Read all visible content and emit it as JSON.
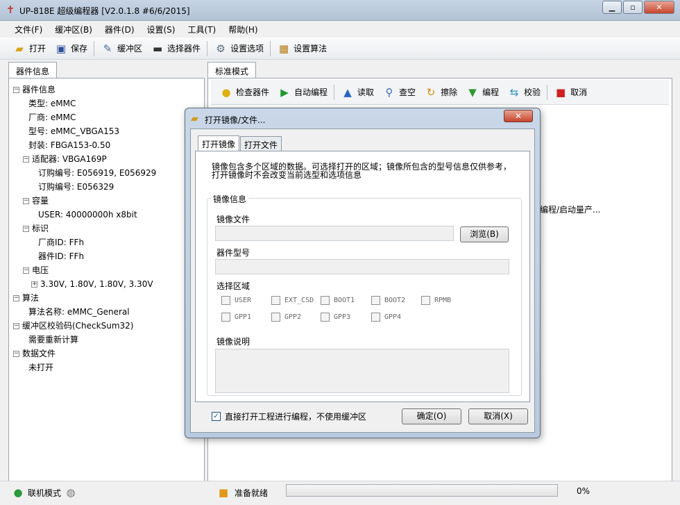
{
  "window": {
    "title": "UP-818E 超级编程器  [V2.0.1.8 #6/6/2015]",
    "minimize": "▁",
    "maximize": "▫",
    "close": "✕"
  },
  "menu": [
    "文件(F)",
    "缓冲区(B)",
    "器件(D)",
    "设置(S)",
    "工具(T)",
    "帮助(H)"
  ],
  "toolbar": {
    "open": "打开",
    "save": "保存",
    "buffer": "缓冲区",
    "select_device": "选择器件",
    "options": "设置选项",
    "algorithm": "设置算法"
  },
  "left_panel": {
    "tab": "器件信息",
    "tree": {
      "device_info": "器件信息",
      "type": "类型: eMMC",
      "vendor": "厂商: eMMC",
      "model": "型号: eMMC_VBGA153",
      "package": "封装: FBGA153-0.50",
      "adapter": "适配器: VBGA169P",
      "order1": "订购编号: E056919, E056929",
      "order2": "订购编号: E056329",
      "capacity": "容量",
      "user_cap": "USER: 40000000h x8bit",
      "ident": "标识",
      "vendor_id": "厂商ID: FFh",
      "device_id": "器件ID: FFh",
      "voltage": "电压",
      "voltage_vals": "3.30V, 1.80V, 1.80V, 3.30V",
      "algo": "算法",
      "algo_name": "算法名称: eMMC_General",
      "checksum": "缓冲区校验码(CheckSum32)",
      "checksum_val": "需要重新计算",
      "datafile": "数据文件",
      "datafile_val": "未打开"
    }
  },
  "right_panel": {
    "tab": "标准模式",
    "buttons": {
      "check": "检查器件",
      "auto": "自动编程",
      "read": "读取",
      "blank": "查空",
      "erase": "擦除",
      "program": "编程",
      "verify": "校验",
      "cancel": "取消"
    },
    "log_fragment": "动编程/启动量产..."
  },
  "dialog": {
    "title": "打开镜像/文件...",
    "tabs": [
      "打开镜像",
      "打开文件"
    ],
    "description_line1": "镜像包含多个区域的数据。可选择打开的区域；镜像所包含的型号信息仅供参考，",
    "description_line2": "打开镜像时不会改变当前选型和选项信息",
    "group_title": "镜像信息",
    "image_file_label": "镜像文件",
    "image_file_value": "",
    "browse": "浏览(B)",
    "device_model_label": "器件型号",
    "device_model_value": "",
    "select_region_label": "选择区域",
    "regions": [
      "USER",
      "EXT_CSD",
      "BOOT1",
      "BOOT2",
      "RPMB",
      "GPP1",
      "GPP2",
      "GPP3",
      "GPP4"
    ],
    "image_desc_label": "镜像说明",
    "direct_open_label": "直接打开工程进行编程，不使用缓冲区",
    "direct_open_checked": true,
    "ok": "确定(O)",
    "cancel": "取消(X)"
  },
  "status": {
    "mode": "联机模式",
    "ready": "准备就绪",
    "progress": 0,
    "percent": "0%"
  }
}
